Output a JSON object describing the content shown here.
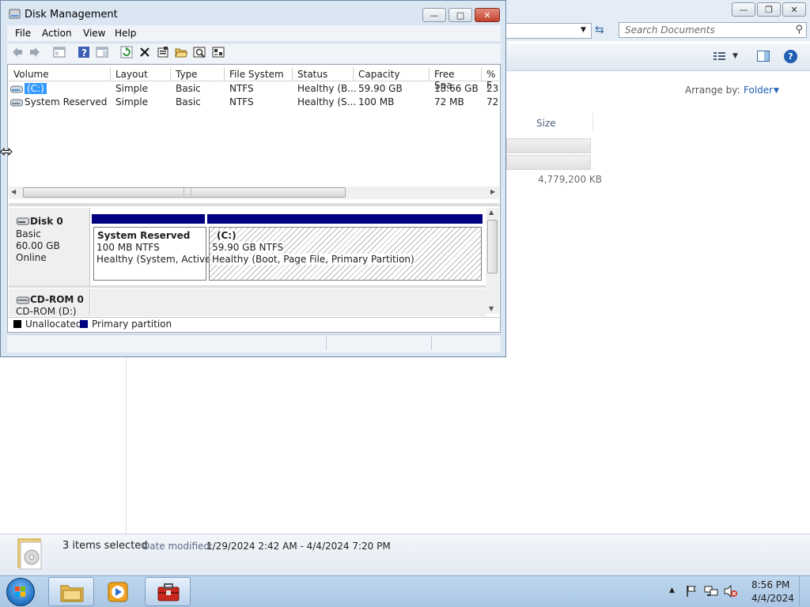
{
  "explorer": {
    "search_placeholder": "Search Documents",
    "arrange_by_label": "Arrange by:",
    "arrange_by_value": "Folder",
    "column_size": "Size",
    "size_value": "4,779,200 KB",
    "details": {
      "items_selected": "3 items selected",
      "date_label": "Date modified:",
      "date_value": "1/29/2024 2:42 AM - 4/4/2024 7:20 PM"
    }
  },
  "disk_mgmt": {
    "title": "Disk Management",
    "menu": [
      "File",
      "Action",
      "View",
      "Help"
    ],
    "columns": [
      "Volume",
      "Layout",
      "Type",
      "File System",
      "Status",
      "Capacity",
      "Free Spa...",
      "% F"
    ],
    "volumes": [
      {
        "volume": "(C:)",
        "layout": "Simple",
        "type": "Basic",
        "fs": "NTFS",
        "status": "Healthy (B...",
        "capacity": "59.90 GB",
        "free": "13.66 GB",
        "pct": "23"
      },
      {
        "volume": "System Reserved",
        "layout": "Simple",
        "type": "Basic",
        "fs": "NTFS",
        "status": "Healthy (S...",
        "capacity": "100 MB",
        "free": "72 MB",
        "pct": "72"
      }
    ],
    "disk0": {
      "name": "Disk 0",
      "type": "Basic",
      "size": "60.00 GB",
      "state": "Online"
    },
    "cdrom0": {
      "name": "CD-ROM 0",
      "sub": "CD-ROM (D:)"
    },
    "partitions": [
      {
        "name": "System Reserved",
        "size": "100 MB NTFS",
        "status": "Healthy (System, Active,"
      },
      {
        "name": "(C:)",
        "size": "59.90 GB NTFS",
        "status": "Healthy (Boot, Page File, Primary Partition)"
      }
    ],
    "legend": {
      "unallocated": "Unallocated",
      "primary": "Primary partition"
    },
    "colors": {
      "primary": "#000080",
      "unallocated": "#000000"
    }
  },
  "tray": {
    "time": "8:56 PM",
    "date": "4/4/2024"
  }
}
